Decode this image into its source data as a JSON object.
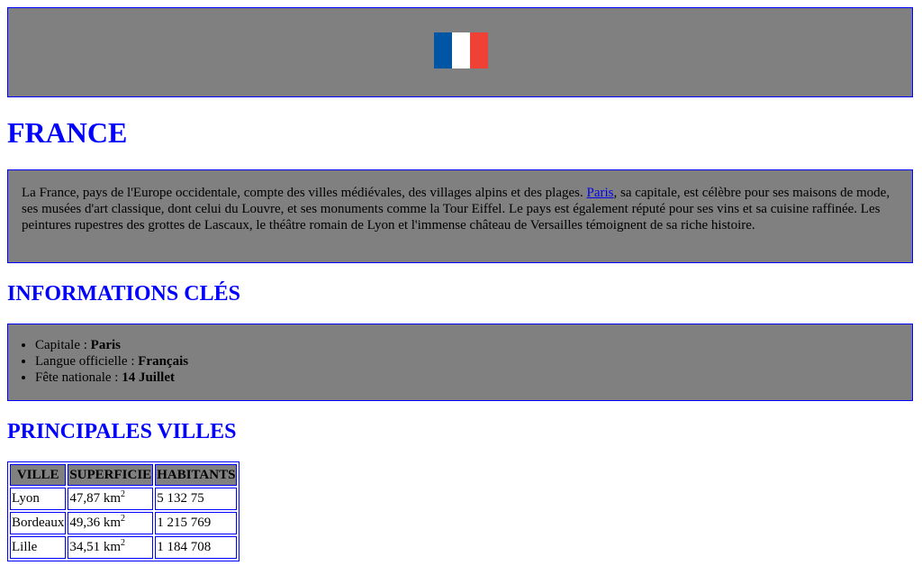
{
  "flag": {
    "colors": [
      "#0055a4",
      "#ffffff",
      "#ef4135"
    ]
  },
  "title": "FRANCE",
  "description": {
    "before_link": "La France, pays de l'Europe occidentale, compte des villes médiévales, des villages alpins et des plages. ",
    "link_text": "Paris",
    "after_link": ", sa capitale, est célèbre pour ses maisons de mode, ses musées d'art classique, dont celui du Louvre, et ses monuments comme la Tour Eiffel. Le pays est également réputé pour ses vins et sa cuisine raffinée. Les peintures rupestres des grottes de Lascaux, le théâtre romain de Lyon et l'immense château de Versailles témoignent de sa riche histoire."
  },
  "info": {
    "heading": "INFORMATIONS CLÉS",
    "items": [
      {
        "label": "Capitale : ",
        "value": "Paris"
      },
      {
        "label": "Langue officielle : ",
        "value": "Français"
      },
      {
        "label": "Fête nationale : ",
        "value": "14 Juillet"
      }
    ]
  },
  "cities": {
    "heading": "PRINCIPALES VILLES",
    "columns": [
      "VILLE",
      "SUPERFICIE",
      "HABITANTS"
    ],
    "unit": "km",
    "unit_exp": "2",
    "rows": [
      {
        "ville": "Lyon",
        "superficie": "47,87",
        "habitants": "5 132 75"
      },
      {
        "ville": "Bordeaux",
        "superficie": "49,36",
        "habitants": "1 215 769"
      },
      {
        "ville": "Lille",
        "superficie": "34,51",
        "habitants": "1 184 708"
      }
    ]
  }
}
